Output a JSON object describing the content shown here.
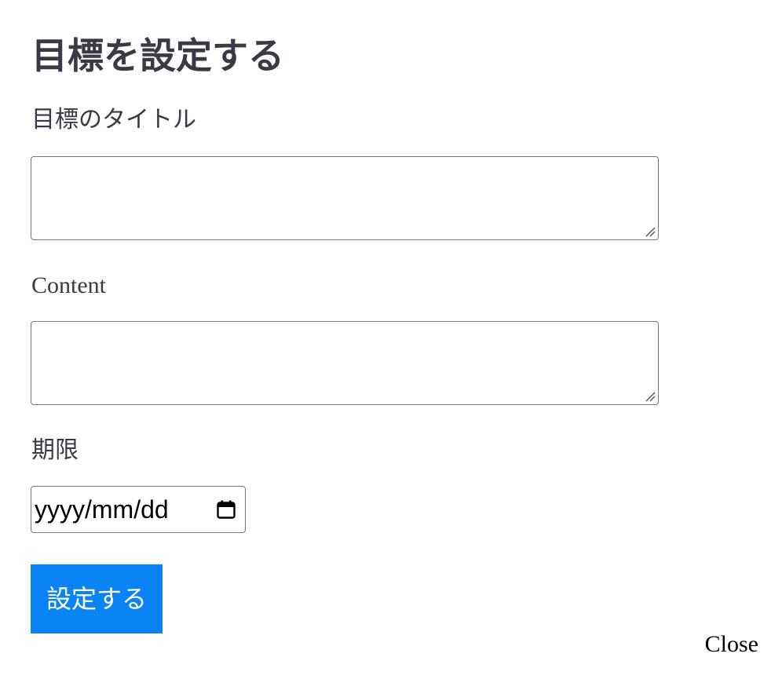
{
  "modal": {
    "title": "目標を設定する",
    "close_label": "Close"
  },
  "form": {
    "title_label": "目標のタイトル",
    "title_value": "",
    "content_label": "Content",
    "content_value": "",
    "deadline_label": "期限",
    "deadline_placeholder": "yyyy/mm/dd",
    "submit_label": "設定する"
  },
  "icons": {
    "calendar": "calendar-icon",
    "resize": "resize-grip-icon"
  },
  "colors": {
    "accent": "#0a84f5",
    "text": "#3a3a45",
    "border": "#767676"
  }
}
